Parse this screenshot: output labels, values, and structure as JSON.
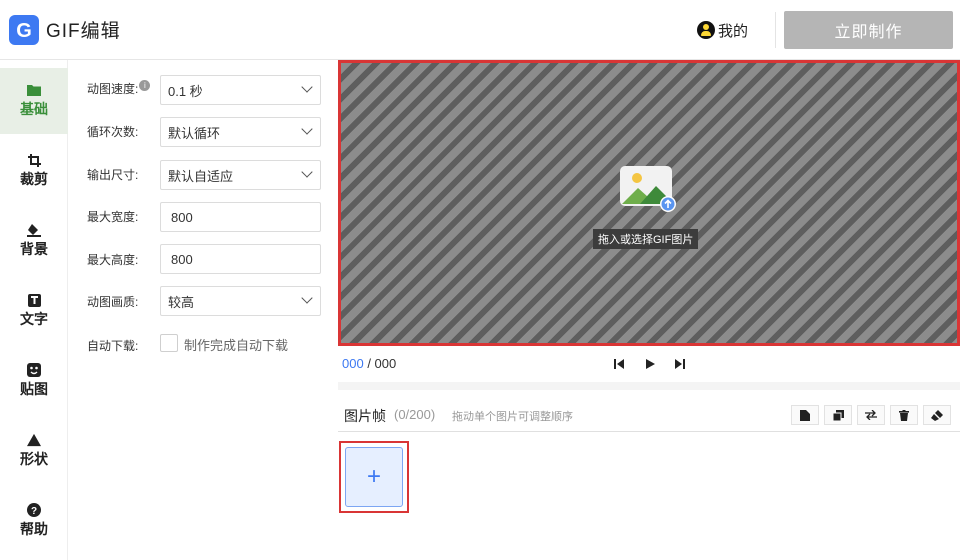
{
  "header": {
    "app_title": "GIF编辑",
    "user_label": "我的",
    "make_button": "立即制作"
  },
  "sidebar": {
    "items": [
      {
        "label": "基础",
        "icon": "folder-icon",
        "active": true
      },
      {
        "label": "裁剪",
        "icon": "crop-icon",
        "active": false
      },
      {
        "label": "背景",
        "icon": "paint-bucket-icon",
        "active": false
      },
      {
        "label": "文字",
        "icon": "text-icon",
        "active": false
      },
      {
        "label": "贴图",
        "icon": "sticker-icon",
        "active": false
      },
      {
        "label": "形状",
        "icon": "triangle-icon",
        "active": false
      },
      {
        "label": "帮助",
        "icon": "help-icon",
        "active": false
      }
    ]
  },
  "settings": {
    "speed": {
      "label": "动图速度:",
      "value": "0.1 秒"
    },
    "loop": {
      "label": "循环次数:",
      "value": "默认循环"
    },
    "output_size": {
      "label": "输出尺寸:",
      "value": "默认自适应"
    },
    "max_width": {
      "label": "最大宽度:",
      "value": "800"
    },
    "max_height": {
      "label": "最大高度:",
      "value": "800"
    },
    "quality": {
      "label": "动图画质:",
      "value": "较高"
    },
    "auto_download": {
      "label": "自动下载:",
      "checkbox_label": "制作完成自动下载",
      "checked": false
    }
  },
  "canvas": {
    "upload_hint": "拖入或选择GIF图片"
  },
  "playback": {
    "current": "000",
    "separator": " / ",
    "total": "000"
  },
  "frames": {
    "title": "图片帧",
    "count": "(0/200)",
    "hint": "拖动单个图片可调整顺序",
    "add_label": "+",
    "tools": [
      "new-file-icon",
      "duplicate-icon",
      "swap-icon",
      "trash-icon",
      "brush-icon"
    ]
  },
  "colors": {
    "accent": "#3d79f2",
    "sidebar_active": "#3a8f3a",
    "highlight_border": "#d93535",
    "button_disabled": "#b5b5b5"
  }
}
